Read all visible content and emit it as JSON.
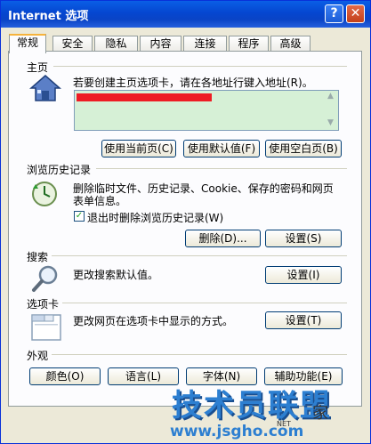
{
  "window": {
    "title": "Internet 选项",
    "help_label": "?",
    "close_label": "✕"
  },
  "tabs": [
    {
      "label": "常规",
      "active": true
    },
    {
      "label": "安全"
    },
    {
      "label": "隐私"
    },
    {
      "label": "内容"
    },
    {
      "label": "连接"
    },
    {
      "label": "程序"
    },
    {
      "label": "高级"
    }
  ],
  "homepage": {
    "section": "主页",
    "description": "若要创建主页选项卡，请在各地址行键入地址(R)。",
    "buttons": {
      "use_current": "使用当前页(C)",
      "use_default": "使用默认值(F)",
      "use_blank": "使用空白页(B)"
    }
  },
  "history": {
    "section": "浏览历史记录",
    "description_line1": "删除临时文件、历史记录、Cookie、保存的密码和网页",
    "description_line2": "表单信息。",
    "checkbox_label": "退出时删除浏览历史记录(W)",
    "checkbox_checked": true,
    "delete_button": "删除(D)...",
    "settings_button": "设置(S)"
  },
  "search": {
    "section": "搜索",
    "description": "更改搜索默认值。",
    "settings_button": "设置(I)"
  },
  "tabs_section": {
    "section": "选项卡",
    "description": "更改网页在选项卡中显示的方式。",
    "settings_button": "设置(T)"
  },
  "appearance": {
    "section": "外观",
    "buttons": {
      "colors": "颜色(O)",
      "languages": "语言(L)",
      "fonts": "字体(N)",
      "accessibility": "辅助功能(E)"
    }
  },
  "watermark": {
    "title": "技术员联盟",
    "suffix": "家",
    "url": "www.jsgho.com",
    "net_label": "NET"
  }
}
